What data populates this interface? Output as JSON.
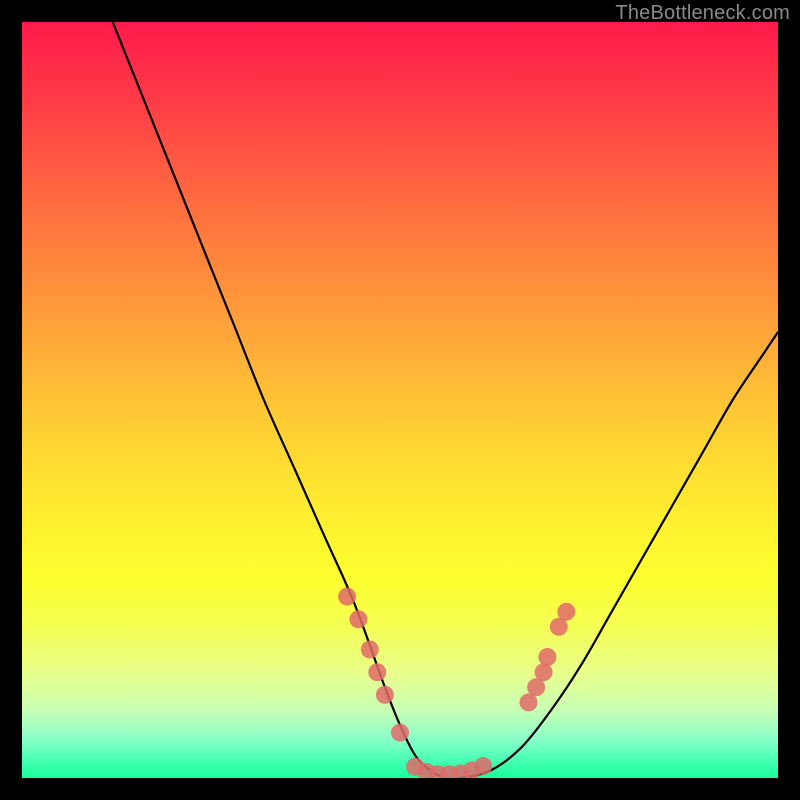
{
  "watermark": "TheBottleneck.com",
  "chart_data": {
    "type": "line",
    "title": "",
    "xlabel": "",
    "ylabel": "",
    "xlim": [
      0,
      100
    ],
    "ylim": [
      0,
      100
    ],
    "grid": false,
    "series": [
      {
        "name": "bottleneck-curve",
        "color": "#000000",
        "x": [
          12,
          16,
          20,
          24,
          28,
          32,
          36,
          40,
          44,
          48,
          50,
          52,
          54,
          56,
          58,
          62,
          66,
          70,
          74,
          78,
          82,
          86,
          90,
          94,
          98,
          100
        ],
        "y": [
          100,
          90,
          80,
          70,
          60,
          50,
          41,
          32,
          23,
          12,
          7,
          3,
          1,
          0,
          0,
          1,
          4,
          9,
          15,
          22,
          29,
          36,
          43,
          50,
          56,
          59
        ]
      }
    ],
    "markers": [
      {
        "name": "left-cluster",
        "color": "#e06a6a",
        "points": [
          {
            "x": 43.0,
            "y": 24.0
          },
          {
            "x": 44.5,
            "y": 21.0
          },
          {
            "x": 46.0,
            "y": 17.0
          },
          {
            "x": 47.0,
            "y": 14.0
          },
          {
            "x": 48.0,
            "y": 11.0
          },
          {
            "x": 50.0,
            "y": 6.0
          }
        ]
      },
      {
        "name": "valley-cluster",
        "color": "#e06a6a",
        "points": [
          {
            "x": 52.0,
            "y": 1.5
          },
          {
            "x": 53.5,
            "y": 0.8
          },
          {
            "x": 55.0,
            "y": 0.5
          },
          {
            "x": 56.5,
            "y": 0.5
          },
          {
            "x": 58.0,
            "y": 0.6
          },
          {
            "x": 59.5,
            "y": 1.0
          },
          {
            "x": 61.0,
            "y": 1.6
          }
        ]
      },
      {
        "name": "right-cluster",
        "color": "#e06a6a",
        "points": [
          {
            "x": 67.0,
            "y": 10.0
          },
          {
            "x": 68.0,
            "y": 12.0
          },
          {
            "x": 69.0,
            "y": 14.0
          },
          {
            "x": 69.5,
            "y": 16.0
          },
          {
            "x": 71.0,
            "y": 20.0
          },
          {
            "x": 72.0,
            "y": 22.0
          }
        ]
      }
    ],
    "gradient_stops": [
      {
        "pos": 0,
        "color": "#ff1a4b"
      },
      {
        "pos": 10,
        "color": "#ff3a47"
      },
      {
        "pos": 22,
        "color": "#ff6540"
      },
      {
        "pos": 33,
        "color": "#ff8a3c"
      },
      {
        "pos": 45,
        "color": "#ffb238"
      },
      {
        "pos": 56,
        "color": "#ffd633"
      },
      {
        "pos": 66,
        "color": "#fff02f"
      },
      {
        "pos": 74,
        "color": "#fcff2f"
      },
      {
        "pos": 80,
        "color": "#f4ff54"
      },
      {
        "pos": 86,
        "color": "#e9ff8a"
      },
      {
        "pos": 91,
        "color": "#c8ffb4"
      },
      {
        "pos": 95,
        "color": "#86ffc8"
      },
      {
        "pos": 98,
        "color": "#3fffb0"
      },
      {
        "pos": 100,
        "color": "#18ff9a"
      }
    ]
  }
}
